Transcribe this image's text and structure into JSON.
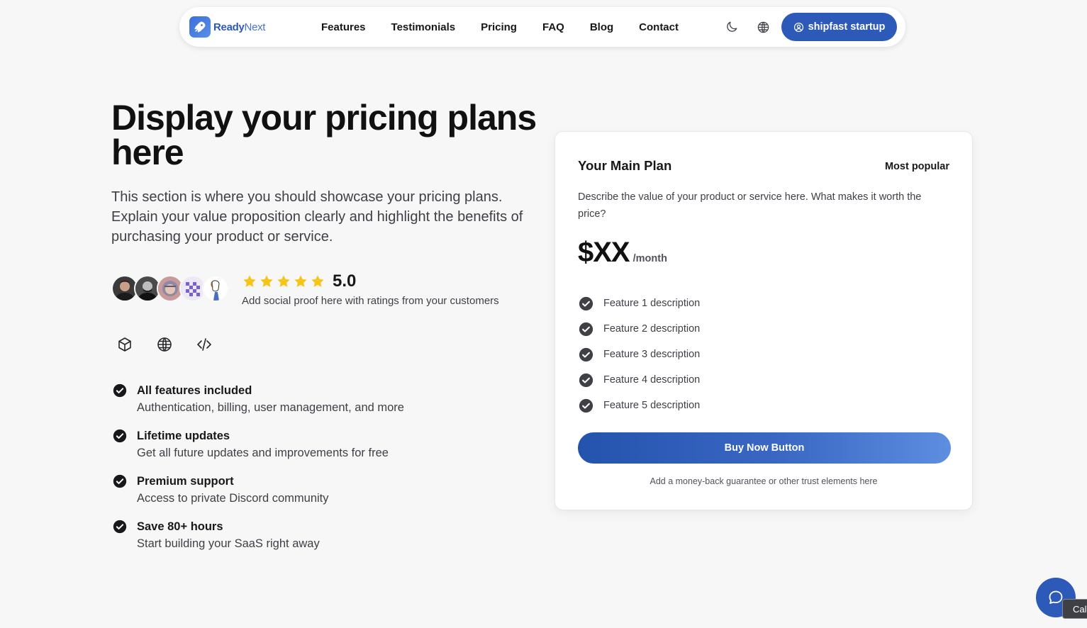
{
  "nav": {
    "logo_ready": "Ready",
    "logo_next": "Next",
    "links": [
      "Features",
      "Testimonials",
      "Pricing",
      "FAQ",
      "Blog",
      "Contact"
    ],
    "cta_label": "shipfast startup",
    "icons": [
      "moon-icon",
      "globe-icon",
      "user-circle-icon",
      "rocket-icon"
    ]
  },
  "hero": {
    "title": "Display your pricing plans here",
    "description": "This section is where you should showcase your pricing plans. Explain your value proposition clearly and highlight the benefits of purchasing your product or service.",
    "rating": "5.0",
    "stars": 5,
    "social_proof": "Add social proof here with ratings from your customers",
    "tech_icons": [
      "box-icon",
      "globe-icon",
      "code-icon"
    ]
  },
  "features": [
    {
      "title": "All features included",
      "desc": "Authentication, billing, user management, and more"
    },
    {
      "title": "Lifetime updates",
      "desc": "Get all future updates and improvements for free"
    },
    {
      "title": "Premium support",
      "desc": "Access to private Discord community"
    },
    {
      "title": "Save 80+ hours",
      "desc": "Start building your SaaS right away"
    }
  ],
  "plan": {
    "name": "Your Main Plan",
    "badge": "Most popular",
    "description": "Describe the value of your product or service here. What makes it worth the price?",
    "price": "$XX",
    "period": "/month",
    "features": [
      "Feature 1 description",
      "Feature 2 description",
      "Feature 3 description",
      "Feature 4 description",
      "Feature 5 description"
    ],
    "buy_label": "Buy Now Button",
    "guarantee": "Add a money-back guarantee or other trust elements here"
  },
  "chat": {
    "tooltip": "Cal"
  },
  "colors": {
    "brand": "#2d59b8",
    "star": "#f5c518",
    "check": "#3f3f46"
  }
}
